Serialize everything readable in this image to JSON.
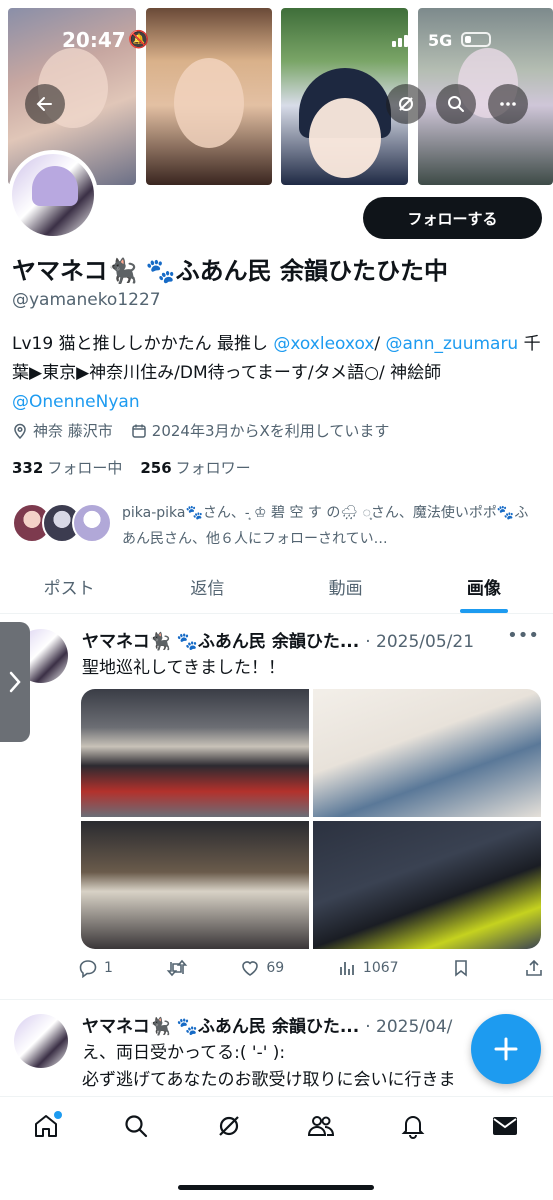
{
  "status": {
    "time": "20:47",
    "network": "5G"
  },
  "profile": {
    "follow_label": "フォローする",
    "display_name": "ヤマネコ🐈‍⬛ 🐾ふあん民 余韻ひたひた中",
    "handle": "@yamaneko1227",
    "bio_parts": {
      "p1": "Lv19 猫と推ししかかたん 最推し ",
      "link1": "@xoxleoxox",
      "p2": "/ ",
      "link2": "@ann_zuumaru",
      "p3": " 千葉▶東京▶神奈川住み/DM待ってまーす/タメ語○/ 神絵師 ",
      "link3": "@OnenneNyan"
    },
    "location": "神奈 藤沢市",
    "joined": "2024年3月からXを利用しています",
    "following_count": "332",
    "following_label": "フォロー中",
    "followers_count": "256",
    "followers_label": "フォロワー",
    "followed_by": "pika-pika🐾さん、-͙ ♔ 碧 空 す の🌧 ◌͙さん、魔法使いポポ🐾ふあん民さん、他６人にフォローされてい…"
  },
  "tabs": [
    {
      "label": "ポスト"
    },
    {
      "label": "返信"
    },
    {
      "label": "動画"
    },
    {
      "label": "画像"
    }
  ],
  "posts": [
    {
      "name": "ヤマネコ🐈‍⬛ 🐾ふあん民 余韻ひた...",
      "date": "· 2025/05/21",
      "text": "聖地巡礼してきました！！",
      "replies": "1",
      "likes": "69",
      "views": "1067"
    },
    {
      "name": "ヤマネコ🐈‍⬛ 🐾ふあん民 余韻ひた...",
      "date": "· 2025/04/",
      "text_line1": "え、両日受かってる:(  '-'  ):",
      "text_line2": "必ず逃げてあなたのお歌受け取りに会いに行きま"
    }
  ],
  "colors": {
    "accent": "#1d9bf0",
    "text": "#0f1419",
    "muted": "#536471"
  }
}
